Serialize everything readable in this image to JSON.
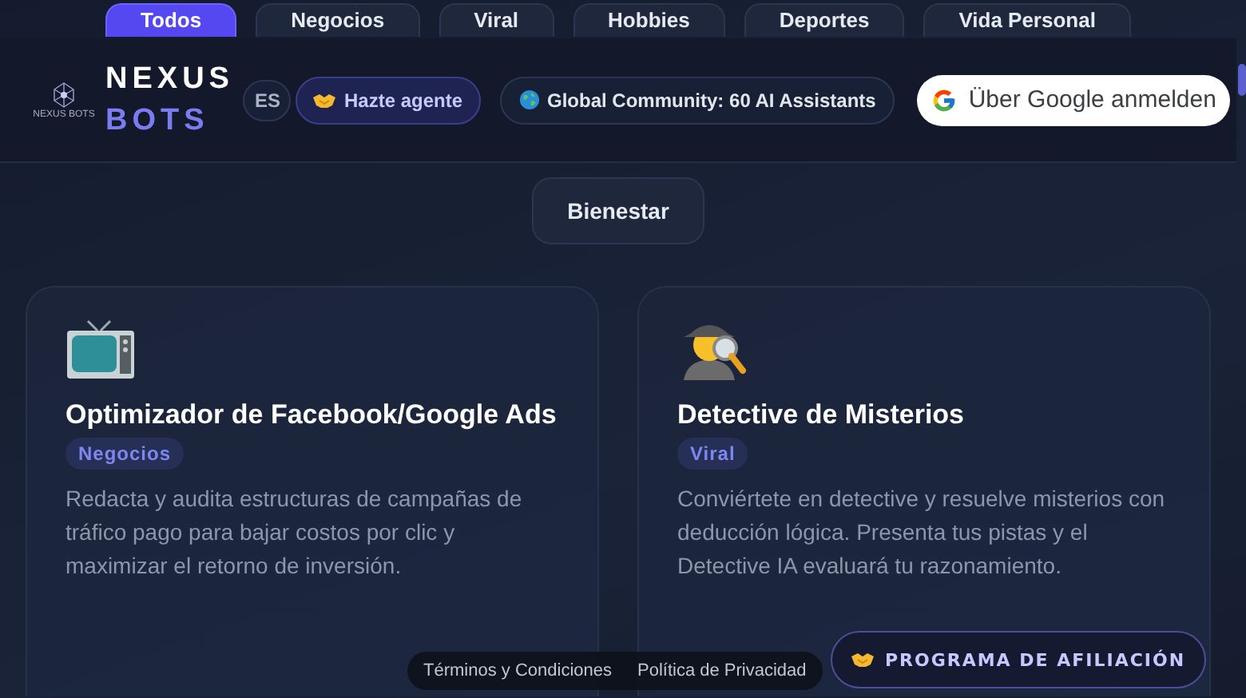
{
  "categories": [
    {
      "label": "Todos",
      "selected": true
    },
    {
      "label": "Negocios",
      "selected": false
    },
    {
      "label": "Viral",
      "selected": false
    },
    {
      "label": "Hobbies",
      "selected": false
    },
    {
      "label": "Deportes",
      "selected": false
    },
    {
      "label": "Vida Personal",
      "selected": false
    },
    {
      "label": "Bienestar",
      "selected": false
    }
  ],
  "header": {
    "brand_top": "NEXUS",
    "brand_bottom": "BOTS",
    "logo_caption": "NEXUS BOTS",
    "language": "ES",
    "agent_button": "Hazte agente",
    "community_badge": "Global Community: 60 AI Assistants",
    "google_button": "Über Google anmelden"
  },
  "cards": [
    {
      "kind": "tv",
      "title": "Optimizador de Facebook/Google Ads",
      "tag": "Negocios",
      "description": "Redacta y audita estructuras de campañas de tráfico pago para bajar costos por clic y maximizar el retorno de inversión."
    },
    {
      "kind": "detective",
      "title": "Detective de Misterios",
      "tag": "Viral",
      "description": "Conviértete en detective y resuelve misterios con deducción lógica. Presenta tus pistas y el Detective IA evaluará tu razonamiento."
    }
  ],
  "footer_links": [
    "Términos y Condiciones",
    "Política de Privacidad"
  ],
  "affiliate_button": "PROGRAMA DE AFILIACIÓN"
}
